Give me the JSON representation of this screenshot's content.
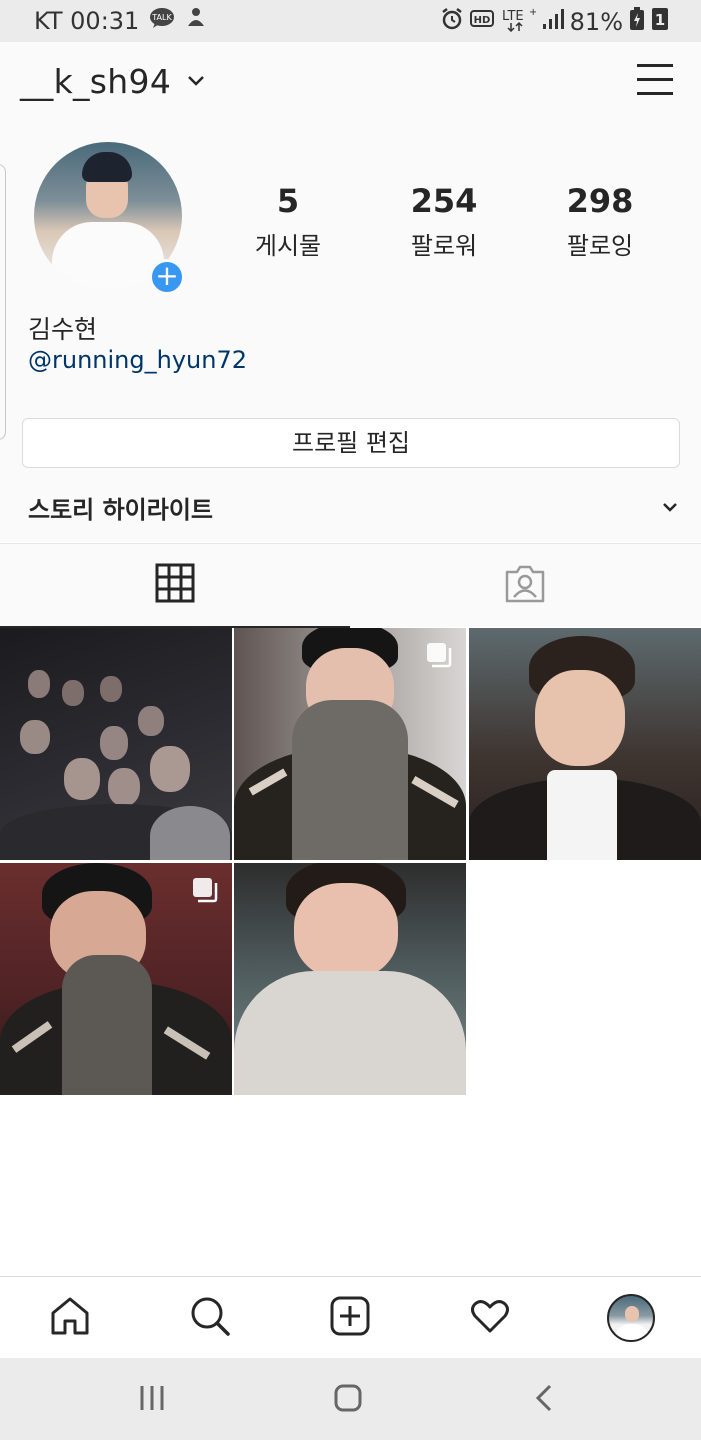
{
  "status_bar": {
    "carrier_time": "KT 00:31",
    "battery": "81%",
    "network": "LTE+"
  },
  "header": {
    "username": "__k_sh94"
  },
  "profile": {
    "stats": [
      {
        "count": "5",
        "label": "게시물"
      },
      {
        "count": "254",
        "label": "팔로워"
      },
      {
        "count": "298",
        "label": "팔로잉"
      }
    ],
    "full_name": "김수현",
    "handle": "@running_hyun72",
    "edit_button": "프로필 편집",
    "highlights_label": "스토리 하이라이트"
  },
  "tabs": [
    "grid",
    "tagged"
  ],
  "grid": {
    "posts": [
      {
        "type": "single",
        "scene": "group-night-selfie"
      },
      {
        "type": "multiple",
        "scene": "selfie-turtleneck"
      },
      {
        "type": "single",
        "scene": "selfie-cafe"
      },
      {
        "type": "multiple",
        "scene": "selfie-red-wall"
      },
      {
        "type": "single",
        "scene": "selfie-white-knit"
      }
    ]
  },
  "bottom_nav": [
    "home",
    "search",
    "new-post",
    "activity",
    "profile"
  ],
  "colors": {
    "accent": "#3897f0",
    "link": "#003569",
    "text": "#262626",
    "header_bg": "#fafafa"
  }
}
